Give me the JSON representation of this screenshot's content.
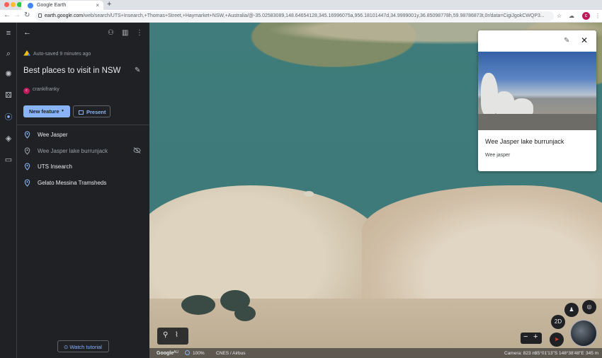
{
  "browser": {
    "tab_title": "Google Earth",
    "tab_close": "×",
    "new_tab": "+",
    "url_host": "earth.google.com",
    "url_path": "/web/search/UTS+Insearch,+Thomas+Street,+Haymarket+NSW,+Australia/@-35.02583089,148.64654128,345.16996075a,956.18101447d,34.9999001y,36.85098778h,59.98786873t,0r/data=CigiJgokCWQP3...",
    "profile_initial": "c",
    "traffic_colors": [
      "#ff5f57",
      "#febc2e",
      "#28c840"
    ]
  },
  "rail": {
    "items": [
      "menu",
      "search",
      "voyager",
      "feeling-lucky",
      "projects",
      "map-style",
      "measure"
    ],
    "active": "projects"
  },
  "panel": {
    "autosave": "Auto-saved 9 minutes ago",
    "title": "Best places to visit in NSW",
    "owner_initial": "c",
    "owner": "crankifranky",
    "new_feature": "New feature",
    "present": "Present",
    "features": [
      {
        "label": "Wee Jasper",
        "hidden": false
      },
      {
        "label": "Wee Jasper lake burrunjack",
        "hidden": true
      },
      {
        "label": "UTS Insearch",
        "hidden": false
      },
      {
        "label": "Gelato Messina Tramsheds",
        "hidden": false
      }
    ],
    "watch_tutorial": "Watch tutorial"
  },
  "card": {
    "title": "Wee Jasper lake burrunjack",
    "description": "Wee jasper"
  },
  "map": {
    "brand": "Google",
    "brand_region": "AU",
    "load_progress": "100%",
    "attribution": "CNES / Airbus",
    "camera": "Camera: 823 m",
    "coords": "35°01'13\"S 148°38'48\"E",
    "elevation": "345 m",
    "view_toggle": "2D",
    "zoom_out": "−",
    "zoom_in": "+"
  },
  "colors": {
    "accent": "#8ab4f8",
    "panel_bg": "#202124",
    "avatar": "#c2185b"
  }
}
